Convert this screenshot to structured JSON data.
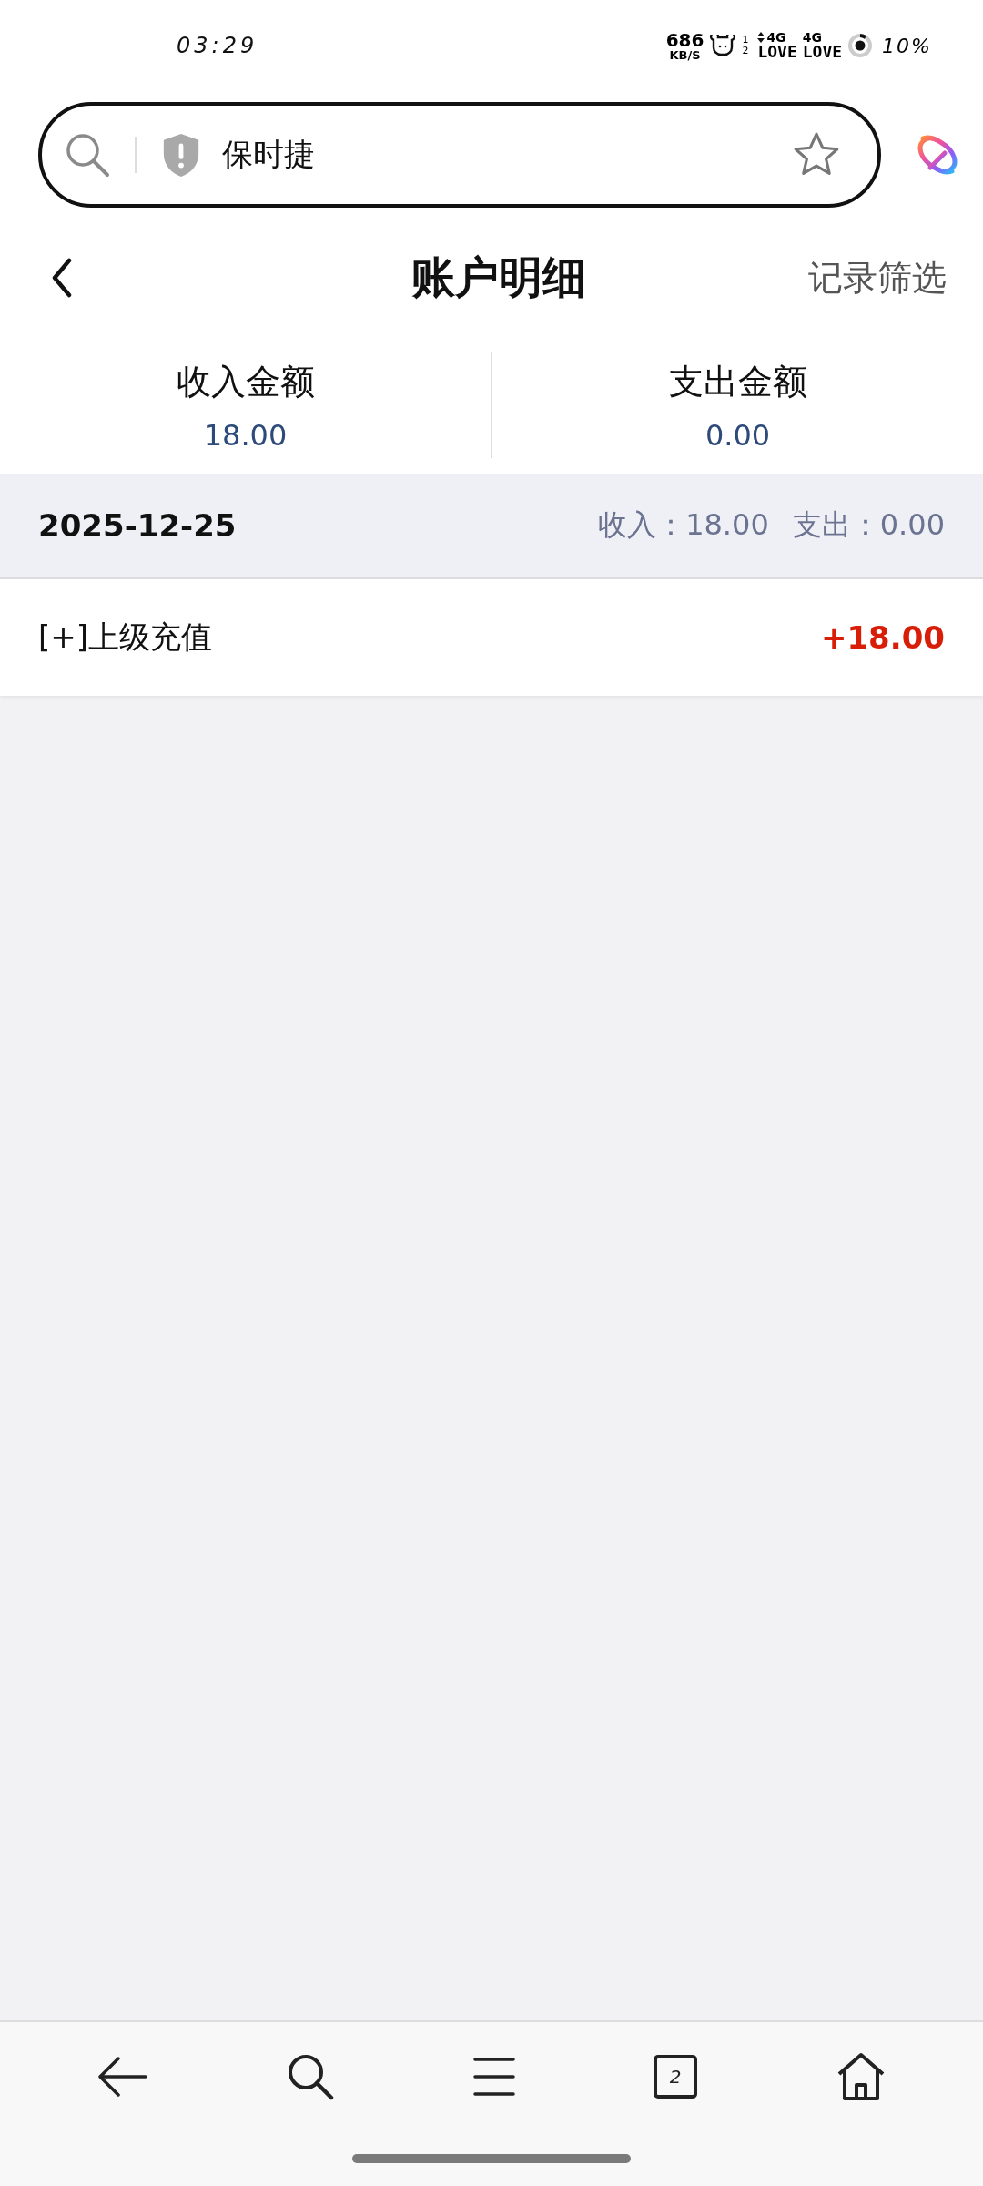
{
  "status_bar": {
    "time": "03:29",
    "net_speed": "686",
    "net_speed_unit": "KB/S",
    "sim_slots": [
      "1",
      "2"
    ],
    "signals": [
      {
        "network": "4G",
        "label": "LOVE",
        "data_active": true
      },
      {
        "network": "4G",
        "label": "LOVE",
        "data_active": false
      }
    ],
    "battery": "10%"
  },
  "address_bar": {
    "value": "保时捷"
  },
  "header": {
    "title": "账户明细",
    "action": "记录筛选"
  },
  "summary": [
    {
      "label": "收入金额",
      "amount": "18.00"
    },
    {
      "label": "支出金额",
      "amount": "0.00"
    }
  ],
  "day_groups": [
    {
      "date": "2025-12-25",
      "income_label": "收入：",
      "income": "18.00",
      "expense_label": "支出：",
      "expense": "0.00",
      "entries": [
        {
          "title": "[+]上级充值",
          "amount": "+18.00",
          "kind": "income"
        }
      ]
    }
  ],
  "bottom_nav": {
    "tab_count": "2"
  }
}
